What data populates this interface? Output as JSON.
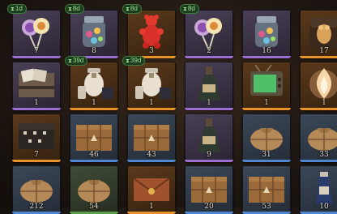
{
  "inventory": {
    "slots": [
      {
        "icon": "lollipop-icon",
        "qty": "7",
        "rarity": "purple",
        "timer": "1d"
      },
      {
        "icon": "candy-jar-icon",
        "qty": "8",
        "rarity": "purple",
        "timer": "8d"
      },
      {
        "icon": "gummy-bear-icon",
        "qty": "3",
        "rarity": "orange",
        "timer": "8d"
      },
      {
        "icon": "lollipop-icon",
        "qty": "2",
        "rarity": "purple",
        "timer": "8d"
      },
      {
        "icon": "candy-jar-icon",
        "qty": "16",
        "rarity": "purple",
        "timer": ""
      },
      {
        "icon": "gift-box-icon",
        "qty": "17",
        "rarity": "orange",
        "timer": ""
      },
      {
        "icon": "photo-chest-icon",
        "qty": "1",
        "rarity": "purple",
        "timer": ""
      },
      {
        "icon": "potion-bundle-icon",
        "qty": "1",
        "rarity": "orange",
        "timer": "39d"
      },
      {
        "icon": "potion-bundle-icon",
        "qty": "1",
        "rarity": "orange",
        "timer": "39d"
      },
      {
        "icon": "bottle-icon",
        "qty": "1",
        "rarity": "purple",
        "timer": ""
      },
      {
        "icon": "tv-icon",
        "qty": "1",
        "rarity": "orange",
        "timer": ""
      },
      {
        "icon": "flame-orb-icon",
        "qty": "1",
        "rarity": "orange",
        "timer": ""
      },
      {
        "icon": "dark-chest-icon",
        "qty": "7",
        "rarity": "orange",
        "timer": ""
      },
      {
        "icon": "wooden-crate-icon",
        "qty": "46",
        "rarity": "blue",
        "timer": ""
      },
      {
        "icon": "wooden-crate-icon",
        "qty": "43",
        "rarity": "blue",
        "timer": ""
      },
      {
        "icon": "bottle-icon",
        "qty": "9",
        "rarity": "purple",
        "timer": ""
      },
      {
        "icon": "sack-icon",
        "qty": "31",
        "rarity": "blue",
        "timer": ""
      },
      {
        "icon": "sack-icon",
        "qty": "33",
        "rarity": "blue",
        "timer": ""
      },
      {
        "icon": "sack-icon",
        "qty": "212",
        "rarity": "blue",
        "timer": ""
      },
      {
        "icon": "sack-icon",
        "qty": "54",
        "rarity": "green",
        "timer": ""
      },
      {
        "icon": "envelope-icon",
        "qty": "1",
        "rarity": "orange",
        "timer": ""
      },
      {
        "icon": "wooden-crate-icon",
        "qty": "20",
        "rarity": "blue",
        "timer": ""
      },
      {
        "icon": "wooden-crate-icon",
        "qty": "53",
        "rarity": "blue",
        "timer": ""
      },
      {
        "icon": "potion-vial-icon",
        "qty": "10",
        "rarity": "blue",
        "timer": ""
      }
    ]
  }
}
